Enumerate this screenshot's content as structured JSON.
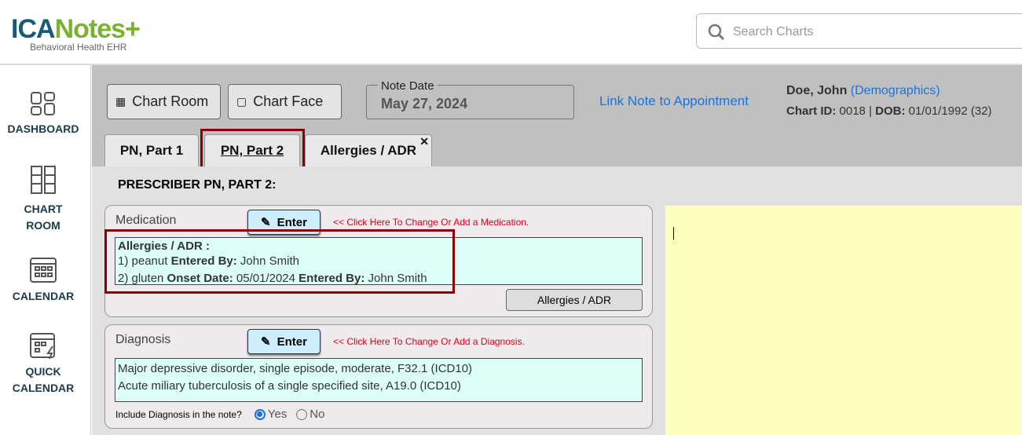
{
  "header": {
    "logo_main": "ICANotes+",
    "logo_sub": "Behavioral Health EHR",
    "search_placeholder": "Search Charts"
  },
  "sidebar": {
    "items": [
      {
        "label": "DASHBOARD"
      },
      {
        "label": "CHART ROOM"
      },
      {
        "label": "CALENDAR"
      },
      {
        "label": "QUICK CALENDAR"
      }
    ]
  },
  "toolbar": {
    "chart_room": "Chart Room",
    "chart_face": "Chart Face",
    "note_date_label": "Note Date",
    "note_date": "May 27, 2024",
    "link_appt": "Link Note to Appointment"
  },
  "patient": {
    "name": "Doe, John",
    "demographics": "(Demographics)",
    "chart_id_label": "Chart ID:",
    "chart_id": "0018",
    "dob_label": "DOB:",
    "dob": "01/01/1992 (32)"
  },
  "tabs": [
    {
      "label": "PN, Part 1"
    },
    {
      "label": "PN, Part 2"
    },
    {
      "label": "Allergies / ADR"
    }
  ],
  "page_title": "PRESCRIBER PN, PART 2:",
  "medication": {
    "label": "Medication",
    "enter": "Enter",
    "hint": "<< Click Here To Change Or Add a Medication.",
    "heading": "Allergies / ADR :",
    "a1_pre": "1) peanut",
    "a1_k1": "Entered By:",
    "a1_v1": "John Smith",
    "a2_pre": "2) gluten",
    "a2_k1": "Onset Date:",
    "a2_v1": "05/01/2024",
    "a2_k2": "Entered By:",
    "a2_v2": "John Smith",
    "allergies_button": "Allergies / ADR"
  },
  "diagnosis": {
    "label": "Diagnosis",
    "enter": "Enter",
    "hint": "<< Click Here To Change Or Add a Diagnosis.",
    "items": [
      "Major depressive disorder, single episode, moderate, F32.1 (ICD10)",
      "Acute miliary tuberculosis of a single specified site, A19.0 (ICD10)"
    ],
    "include_label": "Include Diagnosis in the note?",
    "yes": "Yes",
    "no": "No",
    "selected": "Yes"
  }
}
